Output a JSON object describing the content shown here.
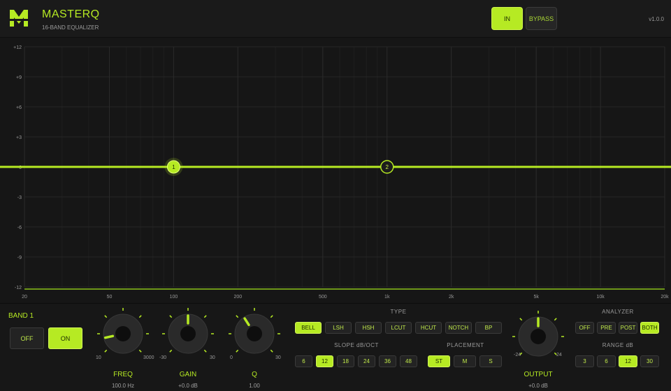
{
  "header": {
    "title": "MASTERQ",
    "subtitle": "16-BAND EQUALIZER",
    "in_label": "IN",
    "bypass_label": "BYPASS",
    "version": "v1.0.0"
  },
  "colors": {
    "accent": "#b6ea23",
    "background": "#161616",
    "grid": "#262626"
  },
  "graph": {
    "y_ticks": [
      "+12",
      "+9",
      "+6",
      "+3",
      "0",
      "-3",
      "-6",
      "-9",
      "-12"
    ],
    "x_ticks": [
      {
        "label": "20",
        "hz": 20
      },
      {
        "label": "50",
        "hz": 50
      },
      {
        "label": "100",
        "hz": 100
      },
      {
        "label": "200",
        "hz": 200
      },
      {
        "label": "500",
        "hz": 500
      },
      {
        "label": "1k",
        "hz": 1000
      },
      {
        "label": "2k",
        "hz": 2000
      },
      {
        "label": "5k",
        "hz": 5000
      },
      {
        "label": "10k",
        "hz": 10000
      },
      {
        "label": "20k",
        "hz": 20000
      }
    ],
    "bands": [
      {
        "label": "1",
        "hz": 100,
        "gain": 0,
        "selected": true
      },
      {
        "label": "2",
        "hz": 1000,
        "gain": 0,
        "selected": false
      }
    ]
  },
  "band": {
    "title": "BAND 1",
    "off_label": "OFF",
    "on_label": "ON",
    "on": true
  },
  "knobs": {
    "freq": {
      "label": "FREQ",
      "value": "100.0 Hz",
      "min": "10",
      "max": "3000",
      "position": 0.12
    },
    "gain": {
      "label": "GAIN",
      "value": "+0.0 dB",
      "min": "-30",
      "max": "30",
      "position": 0.5
    },
    "q": {
      "label": "Q",
      "value": "1.00",
      "min": "0",
      "max": "30",
      "position": 0.38
    },
    "output": {
      "label": "OUTPUT",
      "value": "+0.0 dB",
      "min": "-24",
      "max": "24",
      "position": 0.5
    }
  },
  "type": {
    "label": "TYPE",
    "options": [
      "BELL",
      "LSH",
      "HSH",
      "LCUT",
      "HCUT",
      "NOTCH",
      "BP"
    ],
    "selected": "BELL"
  },
  "slope": {
    "label": "SLOPE dB/OCT",
    "options": [
      "6",
      "12",
      "18",
      "24",
      "36",
      "48"
    ],
    "selected": "12"
  },
  "placement": {
    "label": "PLACEMENT",
    "options": [
      "ST",
      "M",
      "S"
    ],
    "selected": "ST"
  },
  "analyzer": {
    "label": "ANALYZER",
    "options": [
      "OFF",
      "PRE",
      "POST",
      "BOTH"
    ],
    "selected": "BOTH"
  },
  "range": {
    "label": "RANGE dB",
    "options": [
      "3",
      "6",
      "12",
      "30"
    ],
    "selected": "12"
  }
}
